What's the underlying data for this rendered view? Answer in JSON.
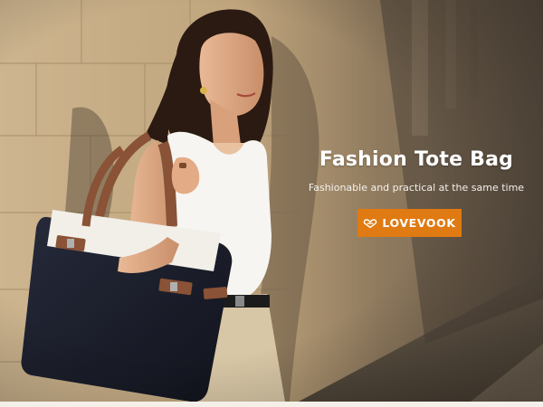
{
  "banner": {
    "headline": "Fashion Tote Bag",
    "subline": "Fashionable and practical at the same time",
    "brand": {
      "label": "LOVEVOOK",
      "icon": "lovevook-logo-icon",
      "color": "#e07a12"
    }
  },
  "colors": {
    "wall": "#c9b08a",
    "shadow": "#5a4a38",
    "bag_body": "#1b1e2b",
    "bag_panel": "#f2efe9",
    "strap": "#8a5236",
    "top": "#f7f5f1",
    "pants": "#d8c7a6"
  }
}
